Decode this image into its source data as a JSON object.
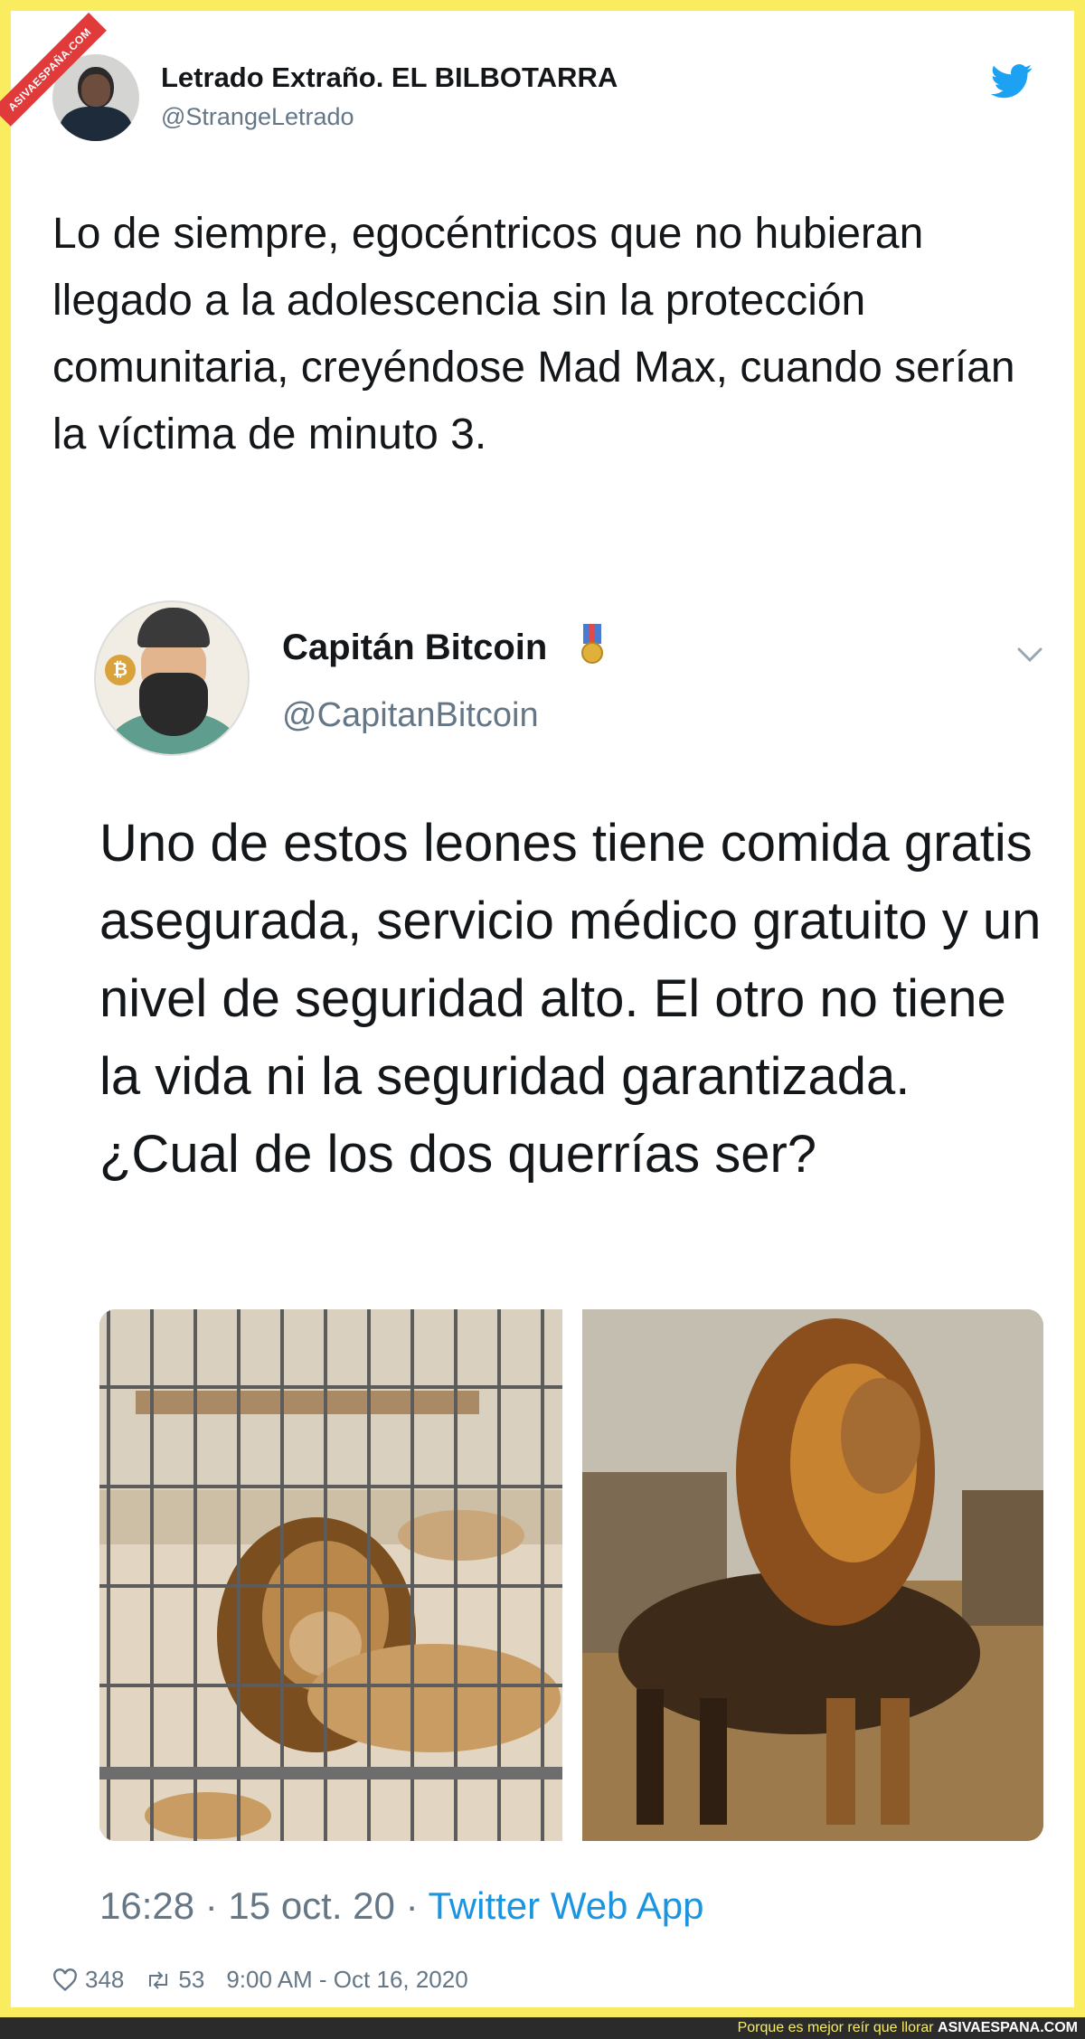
{
  "watermark": {
    "ribbon": "ASIVAESPAÑA.COM"
  },
  "tweet": {
    "author_name": "Letrado Extraño. EL BILBOTARRA",
    "author_handle": "@StrangeLetrado",
    "text": "Lo de siempre, egocéntricos que no hubieran llegado a la adolescencia sin la protección comunitaria, creyéndose Mad Max, cuando serían la víctima de minuto 3.",
    "likes": "348",
    "retweets": "53",
    "timestamp": "9:00 AM - Oct 16, 2020"
  },
  "quoted": {
    "author_name": "Capitán Bitcoin",
    "author_handle": "@CapitanBitcoin",
    "text": "Uno de estos leones tiene comida gratis asegurada, servicio médico gratuito y un nivel de seguridad alto. El otro no tiene la vida ni la seguridad garantizada. ¿Cual de los dos querrías ser?",
    "time": "16:28 · 15 oct. 20 · ",
    "app": "Twitter Web App"
  },
  "bottom_bar": {
    "slogan": "Porque es mejor reír que llorar ",
    "brand": "ASIVAESPANA.COM"
  },
  "colors": {
    "frame": "#f9ec5f",
    "twitter_blue": "#1da1f2",
    "link_blue": "#1b95e0",
    "muted": "#657786"
  }
}
